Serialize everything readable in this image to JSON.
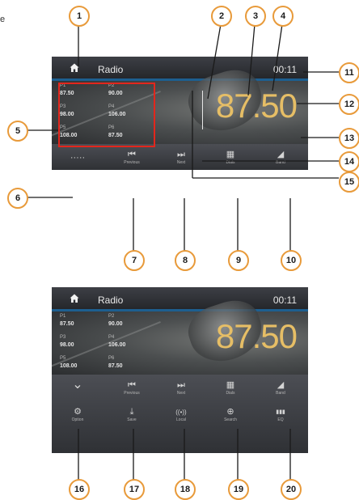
{
  "corner_text": "e",
  "screen_top": {
    "home_icon": "home-icon",
    "title": "Radio",
    "clock": "00:11",
    "frequency": "87.50",
    "presets": [
      {
        "label": "P1",
        "value": "87.50"
      },
      {
        "label": "P2",
        "value": "90.00"
      },
      {
        "label": "P3",
        "value": "98.00"
      },
      {
        "label": "P4",
        "value": "106.00"
      },
      {
        "label": "P5",
        "value": "108.00"
      },
      {
        "label": "P6",
        "value": "87.50"
      }
    ],
    "controls": [
      {
        "icon": "more-dots-icon",
        "symbol": "·····",
        "label": ""
      },
      {
        "icon": "previous-icon",
        "symbol": "⏮",
        "label": "Previous"
      },
      {
        "icon": "next-icon",
        "symbol": "⏭",
        "label": "Next"
      },
      {
        "icon": "dial-pad-icon",
        "symbol": "▦",
        "label": "Dials"
      },
      {
        "icon": "band-icon",
        "symbol": "◢",
        "label": "Band"
      }
    ]
  },
  "screen_bottom": {
    "home_icon": "home-icon",
    "title": "Radio",
    "clock": "00:11",
    "frequency": "87.50",
    "presets": [
      {
        "label": "P1",
        "value": "87.50"
      },
      {
        "label": "P2",
        "value": "90.00"
      },
      {
        "label": "P3",
        "value": "98.00"
      },
      {
        "label": "P4",
        "value": "106.00"
      },
      {
        "label": "P5",
        "value": "108.00"
      },
      {
        "label": "P6",
        "value": "87.50"
      }
    ],
    "controls_row1": [
      {
        "icon": "collapse-chevron-icon",
        "symbol": "⌄",
        "label": ""
      },
      {
        "icon": "previous-icon",
        "symbol": "⏮",
        "label": "Previous"
      },
      {
        "icon": "next-icon",
        "symbol": "⏭",
        "label": "Next"
      },
      {
        "icon": "dial-pad-icon",
        "symbol": "▦",
        "label": "Dials"
      },
      {
        "icon": "band-icon",
        "symbol": "◢",
        "label": "Band"
      }
    ],
    "controls_row2": [
      {
        "icon": "settings-gear-icon",
        "symbol": "⚙",
        "label": "Option"
      },
      {
        "icon": "save-download-icon",
        "symbol": "⤓",
        "label": "Save"
      },
      {
        "icon": "local-signal-icon",
        "symbol": "((•))",
        "label": "Local"
      },
      {
        "icon": "search-zoom-icon",
        "symbol": "⊕",
        "label": "Search"
      },
      {
        "icon": "equalizer-icon",
        "symbol": "▮▮▮",
        "label": "EQ"
      }
    ]
  },
  "callouts": [
    "1",
    "2",
    "3",
    "4",
    "5",
    "6",
    "7",
    "8",
    "9",
    "10",
    "11",
    "12",
    "13",
    "14",
    "15",
    "16",
    "17",
    "18",
    "19",
    "20"
  ],
  "colors": {
    "callout_border": "#e89a3a",
    "highlight_box": "#e3261c",
    "frequency_text": "#e6be66",
    "status_accent": "#1d5f90"
  }
}
